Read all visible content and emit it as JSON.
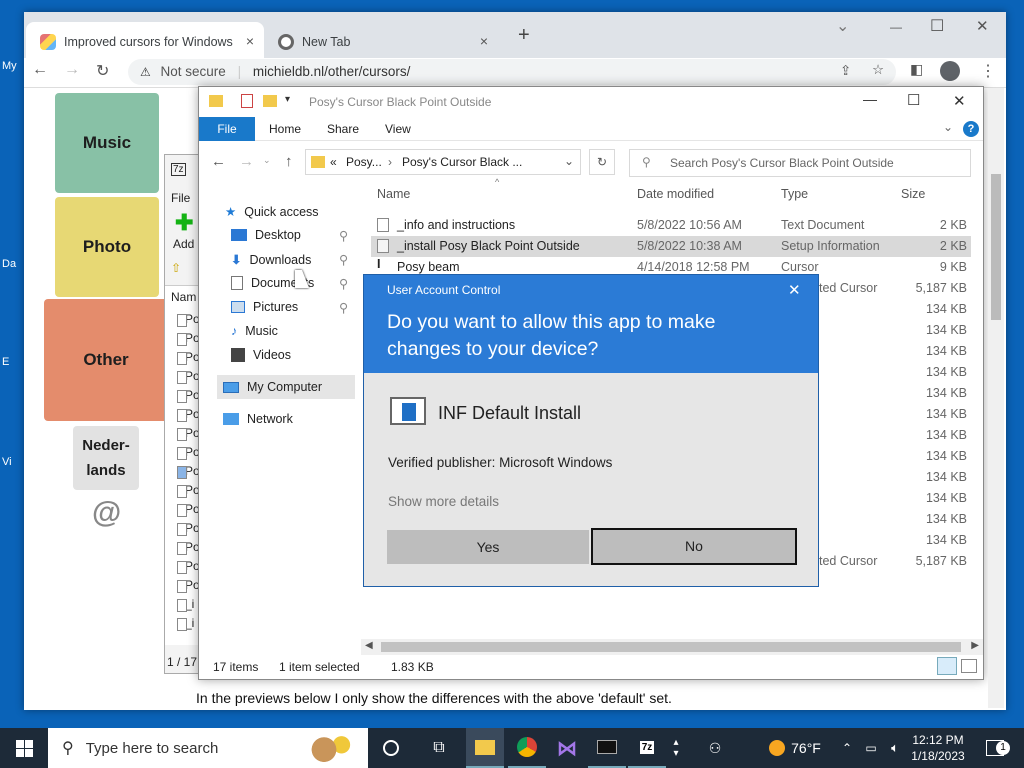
{
  "desktop": {
    "labels": [
      "My",
      "Da",
      "E",
      "Vi"
    ]
  },
  "browser": {
    "tabs": [
      {
        "title": "Improved cursors for Windows 1",
        "close": "×"
      },
      {
        "title": "New Tab",
        "close": "×"
      }
    ],
    "new_tab": "+",
    "window_controls": {
      "minimize": "—",
      "maximize": "☐",
      "close": "✕",
      "dropdown": "⌄"
    },
    "not_secure": "Not secure",
    "url": "michieldb.nl/other/cursors/",
    "nav": {
      "back": "←",
      "forward": "→",
      "reload": "↻"
    }
  },
  "page": {
    "tiles": [
      "Music",
      "Photo",
      "Other"
    ],
    "lang_tile": "Neder-\nlands",
    "at_symbol": "@",
    "footer_text": "In the previews below I only show the differences with the above 'default' set.",
    "sevenzip": {
      "file_menu": "File",
      "add": "Add",
      "name_header": "Nam",
      "rows": [
        "Po",
        "Po",
        "Po",
        "Po",
        "Po",
        "Po",
        "Po",
        "Po",
        "Po",
        "Po",
        "Po",
        "Po",
        "Po",
        "Po",
        "Po",
        "_i",
        "_i"
      ],
      "status": "1 / 17"
    }
  },
  "explorer": {
    "title": "Posy's Cursor Black Point Outside",
    "ribbon": {
      "file": "File",
      "home": "Home",
      "share": "Share",
      "view": "View"
    },
    "breadcrumb": {
      "prefix": "«",
      "parent": "Posy...",
      "current": "Posy's Cursor Black ..."
    },
    "search_placeholder": "Search Posy's Cursor Black Point Outside",
    "nav": {
      "quick_access": "Quick access",
      "desktop": "Desktop",
      "downloads": "Downloads",
      "documents": "Documents",
      "pictures": "Pictures",
      "music": "Music",
      "videos": "Videos",
      "my_computer": "My Computer",
      "network": "Network"
    },
    "columns": {
      "name": "Name",
      "date": "Date modified",
      "type": "Type",
      "size": "Size"
    },
    "files": [
      {
        "name": "_info and instructions",
        "date": "5/8/2022 10:56 AM",
        "type": "Text Document",
        "size": "2 KB"
      },
      {
        "name": "_install Posy Black Point Outside",
        "date": "5/8/2022 10:38 AM",
        "type": "Setup Information",
        "size": "2 KB"
      },
      {
        "name": "Posy beam",
        "date": "4/14/2018 12:58 PM",
        "type": "Cursor",
        "size": "9 KB"
      }
    ],
    "partial_types": [
      "ted Cursor",
      "ted Cursor"
    ],
    "sizes": [
      "5,187 KB",
      "134 KB",
      "134 KB",
      "134 KB",
      "134 KB",
      "134 KB",
      "134 KB",
      "134 KB",
      "134 KB",
      "134 KB",
      "134 KB",
      "134 KB",
      "134 KB",
      "5,187 KB"
    ],
    "status": {
      "items": "17 items",
      "selected": "1 item selected",
      "size": "1.83 KB"
    }
  },
  "uac": {
    "title": "User Account Control",
    "question": "Do you want to allow this app to make changes to your device?",
    "app_name": "INF Default Install",
    "publisher": "Verified publisher: Microsoft Windows",
    "more_details": "Show more details",
    "yes": "Yes",
    "no": "No",
    "close": "✕"
  },
  "taskbar": {
    "search_placeholder": "Type here to search",
    "weather": "76°F",
    "time": "12:12 PM",
    "date": "1/18/2023",
    "notification_count": "1"
  }
}
